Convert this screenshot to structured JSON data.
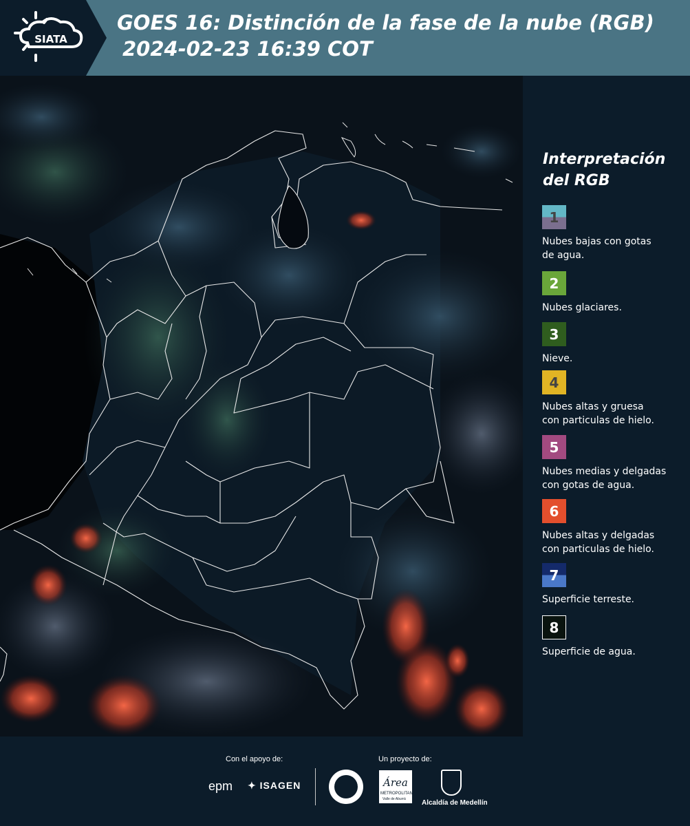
{
  "header": {
    "logo_text": "SIATA",
    "title_line1": "GOES 16: Distinción de la fase de la nube (RGB)",
    "title_line2": "2024-02-23 16:39 COT"
  },
  "legend": {
    "title_line1": "Interpretación",
    "title_line2": "del RGB",
    "items": [
      {
        "num": "1",
        "label_line1": "Nubes bajas con gotas",
        "label_line2": "de agua.",
        "color_top": "#63b7c6",
        "color_bottom": "#7b6f8f",
        "text_color": "#444444"
      },
      {
        "num": "2",
        "label_line1": "Nubes glaciares.",
        "label_line2": "",
        "color_top": "#6aa63a",
        "color_bottom": "#6aa63a",
        "text_color": "#ffffff"
      },
      {
        "num": "3",
        "label_line1": "Nieve.",
        "label_line2": "",
        "color_top": "#2f5d1e",
        "color_bottom": "#2f5d1e",
        "text_color": "#ffffff"
      },
      {
        "num": "4",
        "label_line1": "Nubes altas y gruesa",
        "label_line2": "con particulas de hielo.",
        "color_top": "#e1b424",
        "color_bottom": "#e1b424",
        "text_color": "#444444"
      },
      {
        "num": "5",
        "label_line1": "Nubes medias y delgadas",
        "label_line2": "con gotas de agua.",
        "color_top": "#a24a80",
        "color_bottom": "#a24a80",
        "text_color": "#ffffff"
      },
      {
        "num": "6",
        "label_line1": "Nubes altas y delgadas",
        "label_line2": "con particulas de hielo.",
        "color_top": "#e34f2d",
        "color_bottom": "#e34f2d",
        "text_color": "#ffffff"
      },
      {
        "num": "7",
        "label_line1": "Superficie terreste.",
        "label_line2": "",
        "color_top": "#142a6a",
        "color_bottom": "#4a78c8",
        "text_color": "#ffffff"
      },
      {
        "num": "8",
        "label_line1": "Superficie de agua.",
        "label_line2": "",
        "color_top": "#0a140f",
        "color_bottom": "#0a140f",
        "text_color": "#ffffff"
      }
    ]
  },
  "footer": {
    "support_label": "Con el apoyo de:",
    "project_label": "Un proyecto de:",
    "sponsor1": "epm",
    "sponsor2": "ISAGEN",
    "partner_metro": "METROPOLITANA",
    "partner_metro_sub": "Valle de Aburrá",
    "partner_metro_script": "Área",
    "partner_alcaldia": "Alcaldía de Medellín"
  },
  "colors": {
    "header_bg": "#4a7484",
    "logo_bg": "#0c1c2a",
    "page_bg": "#0c1c2a",
    "map_bg": "#050a10",
    "border_line": "#e8e8e8"
  }
}
